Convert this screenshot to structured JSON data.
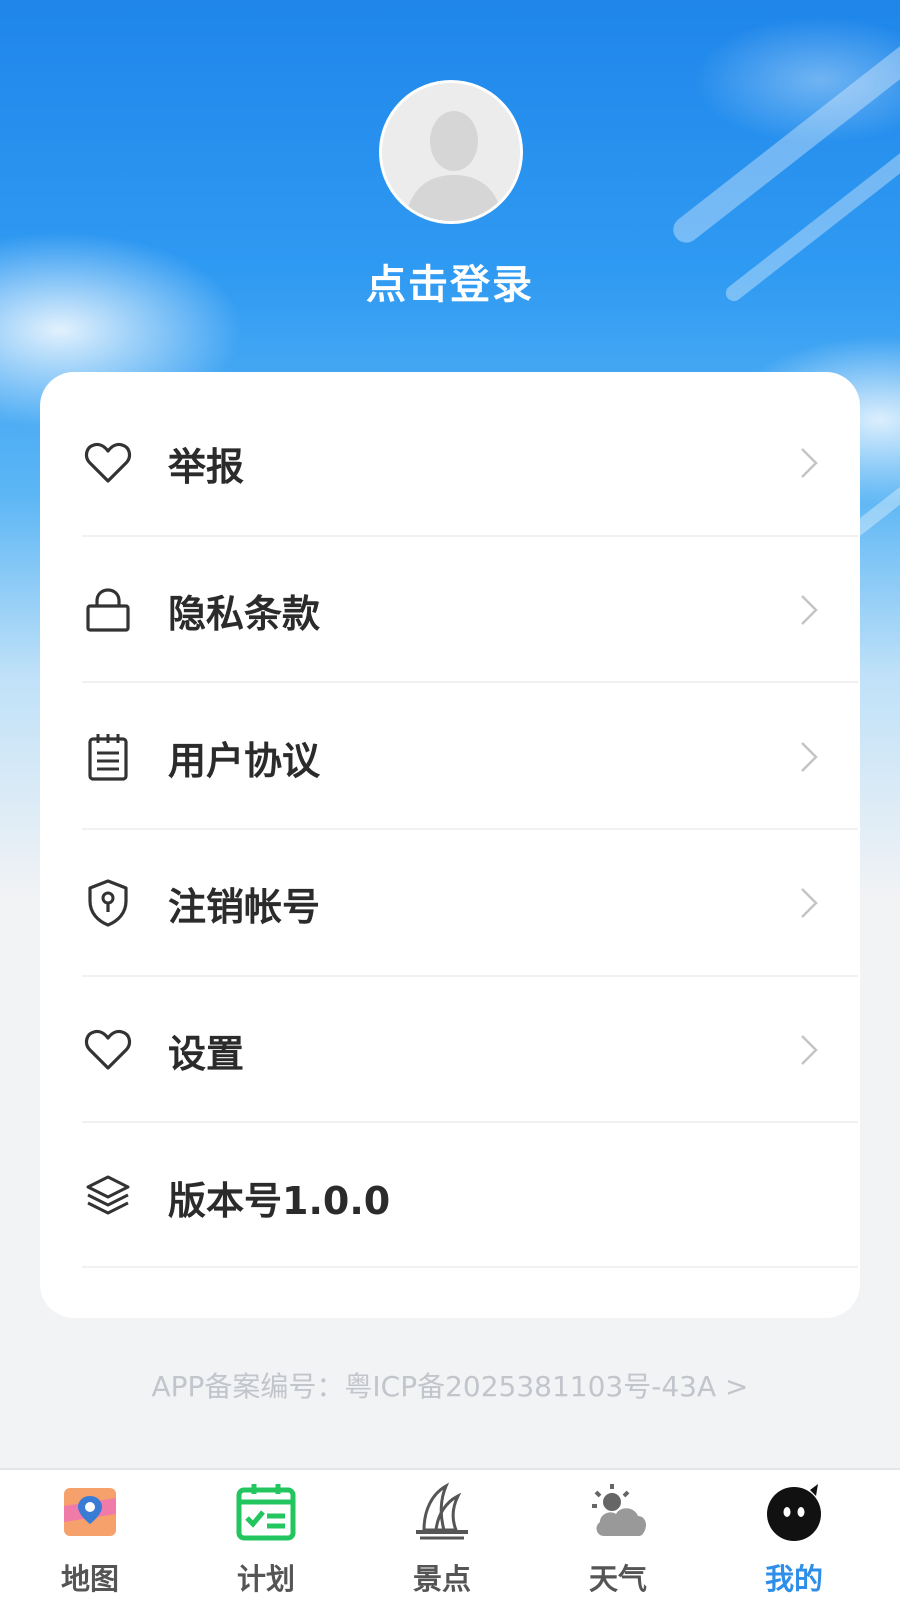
{
  "profile": {
    "avatar_icon": "default-avatar-icon",
    "login_label": "点击登录"
  },
  "menu": {
    "items": [
      {
        "icon": "heart-icon",
        "label": "举报"
      },
      {
        "icon": "lock-icon",
        "label": "隐私条款"
      },
      {
        "icon": "clipboard-icon",
        "label": "用户协议"
      },
      {
        "icon": "shield-keyhole-icon",
        "label": "注销帐号"
      },
      {
        "icon": "heart-icon",
        "label": "设置"
      },
      {
        "icon": "layers-icon",
        "label": "版本号1.0.0"
      }
    ]
  },
  "footer": {
    "icp_text": "APP备案编号：粤ICP备2025381103号-43A >"
  },
  "tabbar": {
    "active_color": "#2f8fe8",
    "tabs": [
      {
        "icon": "map-icon",
        "label": "地图"
      },
      {
        "icon": "plan-calendar-icon",
        "label": "计划"
      },
      {
        "icon": "landmark-icon",
        "label": "景点"
      },
      {
        "icon": "weather-icon",
        "label": "天气"
      },
      {
        "icon": "mascot-icon",
        "label": "我的"
      }
    ]
  }
}
